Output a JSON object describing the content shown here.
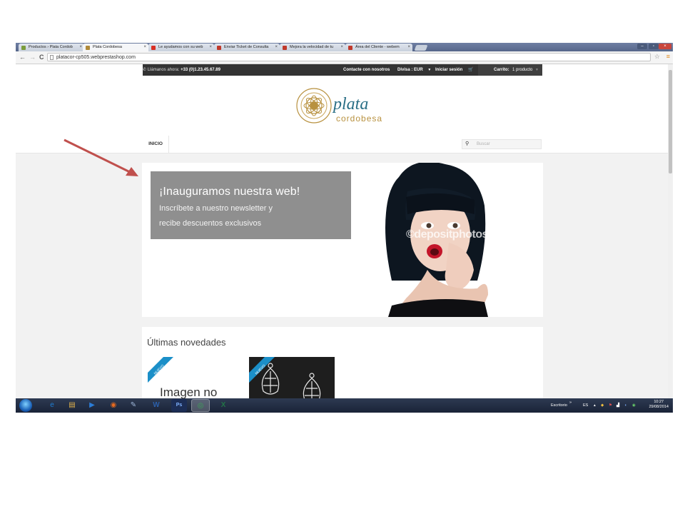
{
  "browser": {
    "tabs": [
      {
        "label": "Productos › Plata Cordob",
        "favicon_color": "#7a9c3c"
      },
      {
        "label": "Plata Cordobesa",
        "favicon_color": "#b08a3a"
      },
      {
        "label": "Le ayudamos con su web",
        "favicon_color": "#d93025"
      },
      {
        "label": "Enviar Ticket de Consulta",
        "favicon_color": "#c0392b"
      },
      {
        "label": "Mejora la velocidad de tu",
        "favicon_color": "#c0392b"
      },
      {
        "label": "Área del Cliente - webem",
        "favicon_color": "#c0392b"
      }
    ],
    "close_glyph": "×",
    "url": "platacor-cp505.webprestashop.com",
    "back_icon": "arrow-left-icon",
    "forward_icon": "arrow-right-icon",
    "reload_icon": "reload-icon",
    "back_glyph": "←",
    "forward_glyph": "→",
    "reload_glyph": "C",
    "star_glyph": "☆",
    "menu_glyph": "≡"
  },
  "shop": {
    "topbar": {
      "call_label": "Llámanos ahora:",
      "phone": "+33 (0)1.23.45.67.89",
      "contact_label": "Contacte con nosotros",
      "currency_label": "Divisa : EUR",
      "login_label": "Iniciar sesión",
      "cart_label": "Carrito:",
      "cart_count": "1 producto",
      "phone_glyph": "✆",
      "dropdown_glyph": "▼",
      "cart_glyph": "🛒"
    },
    "logo": {
      "line1": "plata",
      "line2": "cordobesa"
    },
    "nav": {
      "home_label": "INICIO",
      "search_placeholder": "Buscar",
      "search_glyph": "⚲"
    },
    "banner": {
      "title": "¡Inauguramos nuestra web!",
      "line1": "Inscríbete a nuestro newsletter y",
      "line2": "recibe descuentos exclusivos",
      "watermark": "©depositphotos"
    },
    "products": {
      "heading": "Últimas novedades",
      "badge_label": "NUEVO",
      "no_image_label": "Imagen no"
    }
  },
  "taskbar": {
    "desktop_label": "Escritorio",
    "chevron_glyph": "»",
    "language": "ES",
    "time": "10:27",
    "date": "29/08/2014",
    "apps": [
      {
        "icon": "internet-explorer-icon",
        "glyph": "e",
        "color": "#1e7fd6"
      },
      {
        "icon": "file-explorer-icon",
        "glyph": "▤",
        "color": "#e2b44c"
      },
      {
        "icon": "media-player-icon",
        "glyph": "▶",
        "color": "#2b7cd6"
      },
      {
        "icon": "firefox-icon",
        "glyph": "◉",
        "color": "#e66a1f"
      },
      {
        "icon": "notepad-icon",
        "glyph": "✎",
        "color": "#9fb7d9"
      },
      {
        "icon": "word-icon",
        "glyph": "W",
        "color": "#2b5faa"
      },
      {
        "icon": "photoshop-icon",
        "glyph": "Ps",
        "color": "#2b4c8c"
      },
      {
        "icon": "chrome-icon",
        "glyph": "◎",
        "color": "#3aa757"
      },
      {
        "icon": "excel-icon",
        "glyph": "X",
        "color": "#217346"
      }
    ]
  },
  "colors": {
    "accent_arrow": "#c0504d",
    "banner_box": "#8f8f8f",
    "topbar": "#333333",
    "badge": "#1b8fc8",
    "gold": "#b8913f",
    "teal": "#2a6f86"
  }
}
